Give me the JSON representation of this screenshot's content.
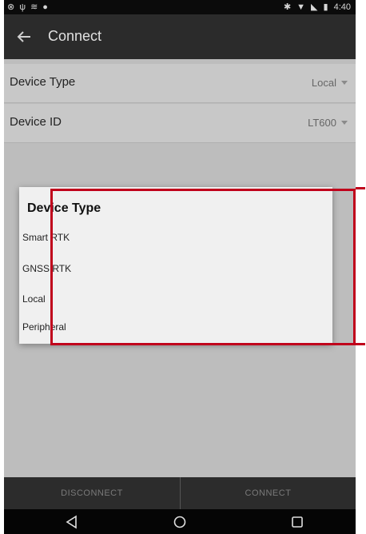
{
  "status_bar": {
    "time": "4:40"
  },
  "toolbar": {
    "title": "Connect"
  },
  "settings": [
    {
      "label": "Device Type",
      "value": "Local"
    },
    {
      "label": "Device ID",
      "value": "LT600"
    }
  ],
  "dialog": {
    "title": "Device Type",
    "options": [
      "Smart RTK",
      "GNSS RTK",
      "Local",
      "Peripheral"
    ]
  },
  "bottom_bar": {
    "disconnect_label": "DISCONNECT",
    "connect_label": "CONNECT"
  },
  "colors": {
    "toolbar": "#2b2b2b",
    "background": "#bdbdbd",
    "dialog": "#f0f0f0",
    "highlight": "#c0001b"
  }
}
